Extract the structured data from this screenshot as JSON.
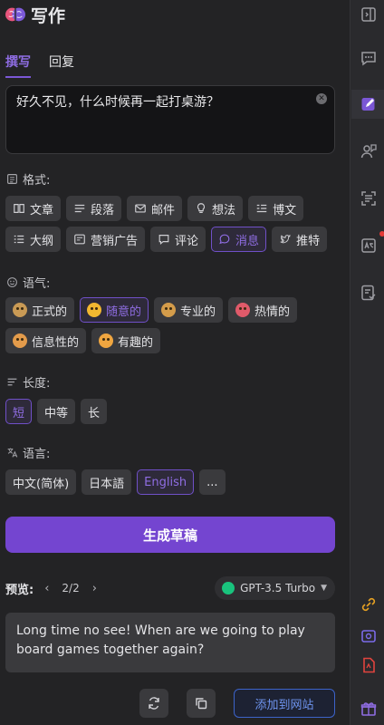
{
  "app": {
    "title": "写作"
  },
  "tabs": [
    {
      "label": "撰写",
      "active": true
    },
    {
      "label": "回复",
      "active": false
    }
  ],
  "input": {
    "value": "好久不见，什么时候再一起打桌游？"
  },
  "format": {
    "label": "格式:",
    "chips": [
      {
        "label": "文章",
        "icon": "book-icon",
        "active": false
      },
      {
        "label": "段落",
        "icon": "paragraph-icon",
        "active": false
      },
      {
        "label": "邮件",
        "icon": "mail-icon",
        "active": false
      },
      {
        "label": "想法",
        "icon": "lightbulb-icon",
        "active": false
      },
      {
        "label": "博文",
        "icon": "blog-icon",
        "active": false
      },
      {
        "label": "大纲",
        "icon": "outline-icon",
        "active": false
      },
      {
        "label": "营销广告",
        "icon": "ad-icon",
        "active": false
      },
      {
        "label": "评论",
        "icon": "comment-icon",
        "active": false
      },
      {
        "label": "消息",
        "icon": "message-icon",
        "active": true
      },
      {
        "label": "推特",
        "icon": "twitter-icon",
        "active": false
      }
    ]
  },
  "tone": {
    "label": "语气:",
    "chips": [
      {
        "label": "正式的",
        "active": false,
        "color": "#c99a55"
      },
      {
        "label": "随意的",
        "active": true,
        "color": "#f2b730"
      },
      {
        "label": "专业的",
        "active": false,
        "color": "#d49c4a"
      },
      {
        "label": "热情的",
        "active": false,
        "color": "#e05a6a"
      },
      {
        "label": "信息性的",
        "active": false,
        "color": "#e39b4b"
      },
      {
        "label": "有趣的",
        "active": false,
        "color": "#f0a640"
      }
    ]
  },
  "length": {
    "label": "长度:",
    "chips": [
      {
        "label": "短",
        "active": true
      },
      {
        "label": "中等",
        "active": false
      },
      {
        "label": "长",
        "active": false
      }
    ]
  },
  "language": {
    "label": "语言:",
    "chips": [
      {
        "label": "中文(简体)",
        "active": false
      },
      {
        "label": "日本語",
        "active": false
      },
      {
        "label": "English",
        "active": true
      },
      {
        "label": "...",
        "active": false
      }
    ]
  },
  "generate": {
    "label": "生成草稿"
  },
  "preview": {
    "label": "预览:",
    "page": "2/2",
    "model": "GPT-3.5 Turbo"
  },
  "result": {
    "text": "Long time no see! When are we going to play board games together again?"
  },
  "actions": {
    "add_to_site": "添加到网站"
  },
  "colors": {
    "accent": "#7445d0",
    "accent_text": "#8f6de3",
    "link_blue": "#6f95f0",
    "background": "#232325"
  }
}
